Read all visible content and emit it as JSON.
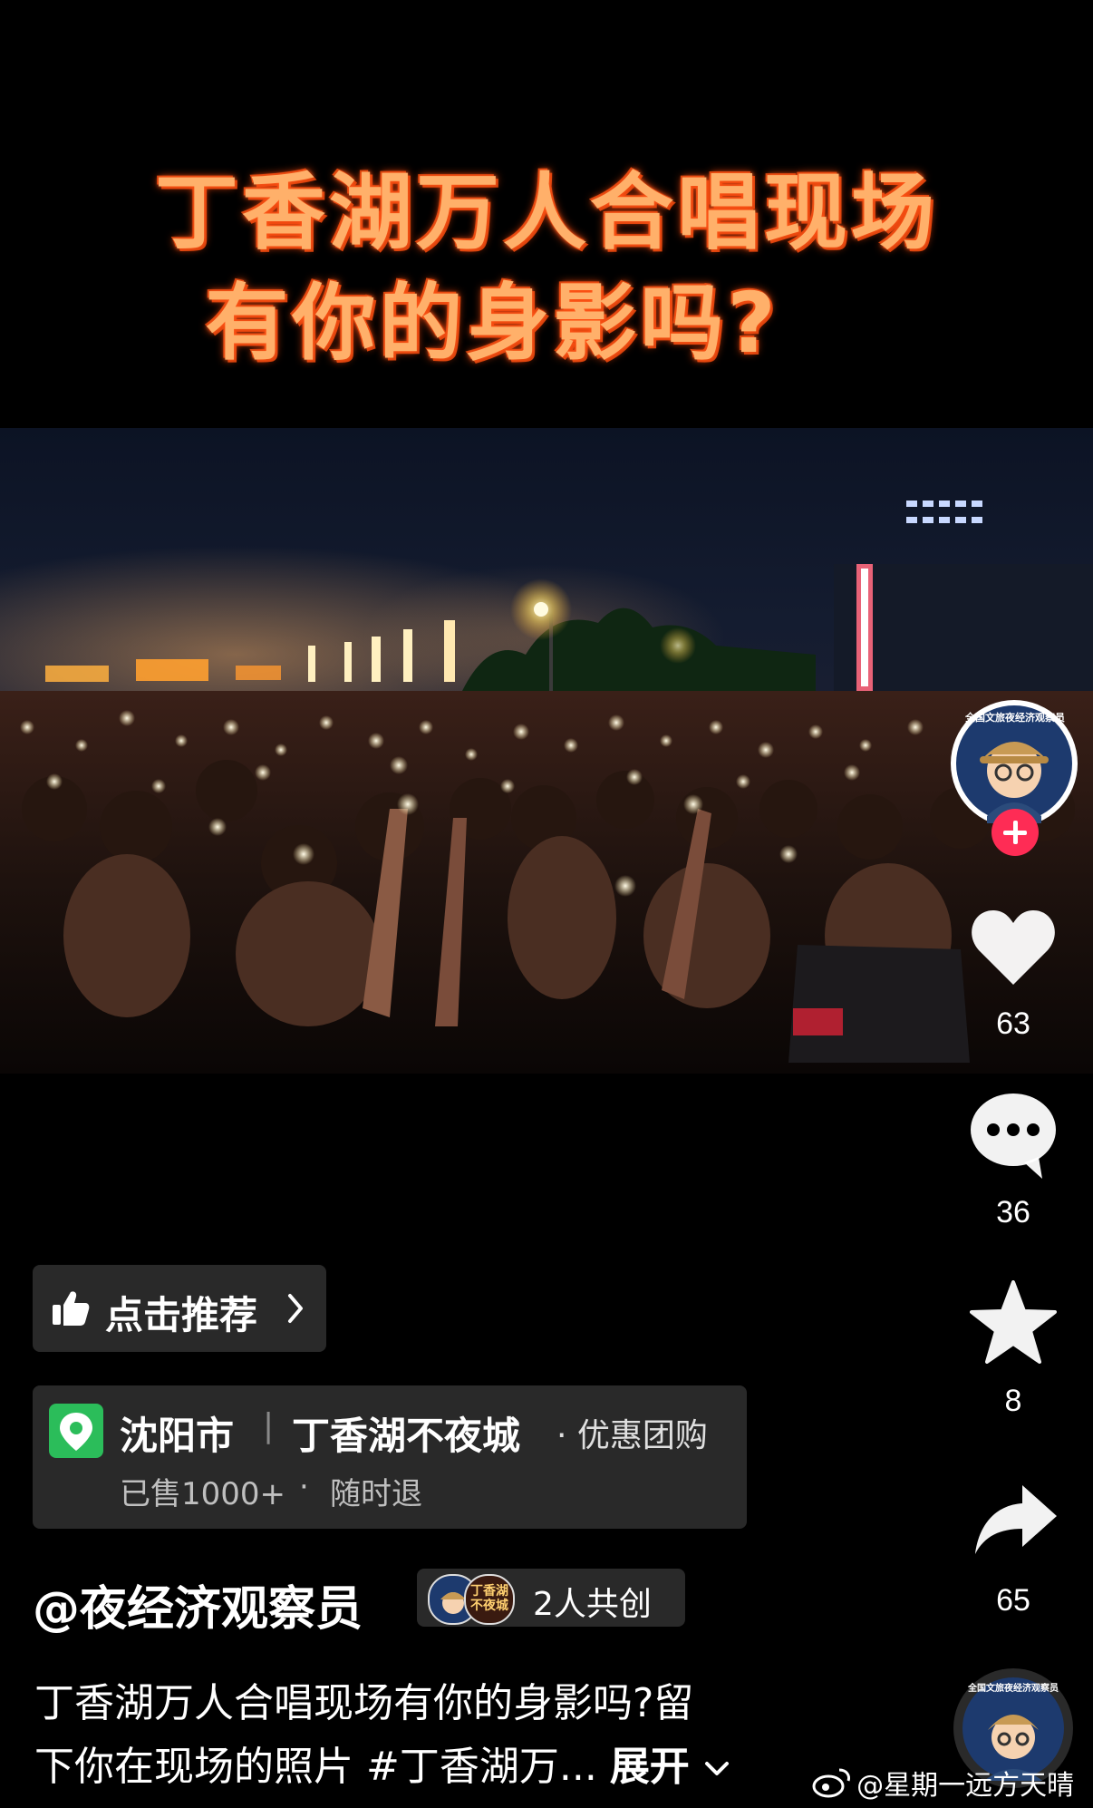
{
  "overlay": {
    "title_line1": "丁香湖万人合唱现场",
    "title_line2": "有你的身影吗?"
  },
  "author_avatar": {
    "badge_text": "全国文旅夜经济观察员",
    "follow_icon": "plus-icon"
  },
  "actions": {
    "like": {
      "icon": "heart-icon",
      "count": "63"
    },
    "comment": {
      "icon": "comment-icon",
      "count": "36"
    },
    "favorite": {
      "icon": "star-icon",
      "count": "8"
    },
    "share": {
      "icon": "share-icon",
      "count": "65"
    }
  },
  "recommend": {
    "label": "点击推荐",
    "icon": "thumbs-up-icon",
    "chevron": "chevron-right-icon"
  },
  "location": {
    "icon": "map-pin-icon",
    "city": "沈阳市",
    "separator": "|",
    "place": "丁香湖不夜城",
    "tag": "· 优惠团购",
    "sold": "已售1000+",
    "dot": "·",
    "refund": "随时退"
  },
  "author": {
    "handle": "@夜经济观察员",
    "collab_label": "2人共创",
    "collab_avatar2_text": "丁香湖不夜城"
  },
  "caption": {
    "line1": "丁香湖万人合唱现场有你的身影吗?留",
    "line2": "下你在现场的照片 #丁香湖万...",
    "expand": "展开"
  },
  "music_disc": {
    "badge_text": "全国文旅夜经济观察员"
  },
  "watermark": {
    "icon": "weibo-icon",
    "text": "@星期一远方天晴"
  },
  "colors": {
    "accent_red": "#fe2c55",
    "pin_green": "#2bbd5a",
    "title_orange": "#ffb06a"
  }
}
